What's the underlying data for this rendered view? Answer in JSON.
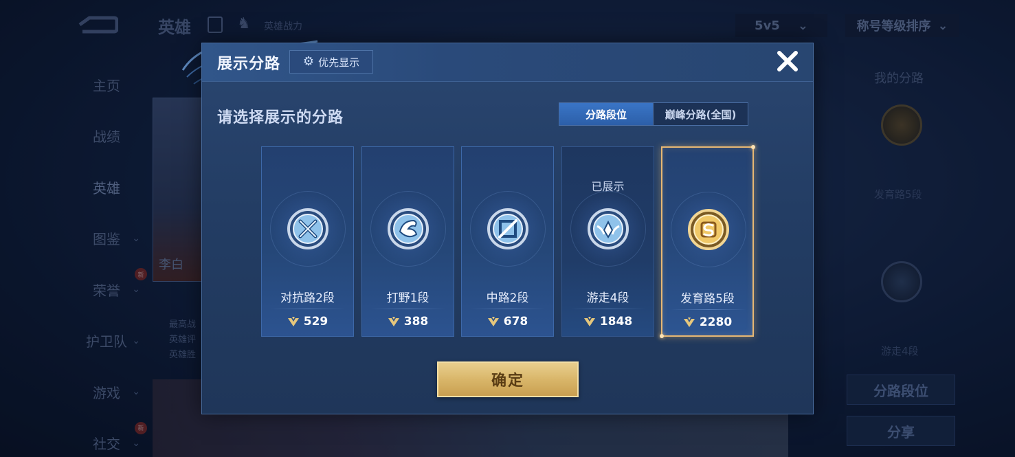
{
  "background": {
    "page_title": "英雄",
    "power_label": "英雄战力",
    "mode_select": "5v5",
    "sort_select": "称号等级排序",
    "nav": [
      {
        "label": "主页",
        "chevron": false,
        "badge": ""
      },
      {
        "label": "战绩",
        "chevron": false,
        "badge": ""
      },
      {
        "label": "英雄",
        "chevron": false,
        "badge": ""
      },
      {
        "label": "图鉴",
        "chevron": true,
        "badge": ""
      },
      {
        "label": "荣誉",
        "chevron": true,
        "badge": "新"
      },
      {
        "label": "护卫队",
        "chevron": true,
        "badge": ""
      },
      {
        "label": "游戏",
        "chevron": true,
        "badge": ""
      },
      {
        "label": "社交",
        "chevron": true,
        "badge": "新"
      }
    ],
    "hero_name": "李白",
    "hero_info": [
      "最高战",
      "英雄评",
      "英雄胜"
    ],
    "right_panel": {
      "title": "我的分路",
      "lane1": "发育路5段",
      "lane2": "游走4段",
      "btn_lane_rank": "分路段位",
      "btn_share": "分享"
    }
  },
  "modal": {
    "title": "展示分路",
    "priority_label": "优先显示",
    "prompt": "请选择展示的分路",
    "tabs": [
      {
        "label": "分路段位",
        "active": true
      },
      {
        "label": "巅峰分路(全国)",
        "active": false
      }
    ],
    "shown_label": "已展示",
    "lanes": [
      {
        "name": "对抗路2段",
        "score": "529",
        "emblem": "clash-lane-icon",
        "state": "normal"
      },
      {
        "name": "打野1段",
        "score": "388",
        "emblem": "jungle-icon",
        "state": "normal"
      },
      {
        "name": "中路2段",
        "score": "678",
        "emblem": "mid-lane-icon",
        "state": "normal"
      },
      {
        "name": "游走4段",
        "score": "1848",
        "emblem": "roam-icon",
        "state": "shown"
      },
      {
        "name": "发育路5段",
        "score": "2280",
        "emblem": "farm-lane-icon",
        "state": "selected"
      }
    ],
    "confirm_label": "确定"
  },
  "colors": {
    "accent_blue": "#2c5fa9",
    "gold": "#d9b66a",
    "selected_border": "#e8b873"
  }
}
